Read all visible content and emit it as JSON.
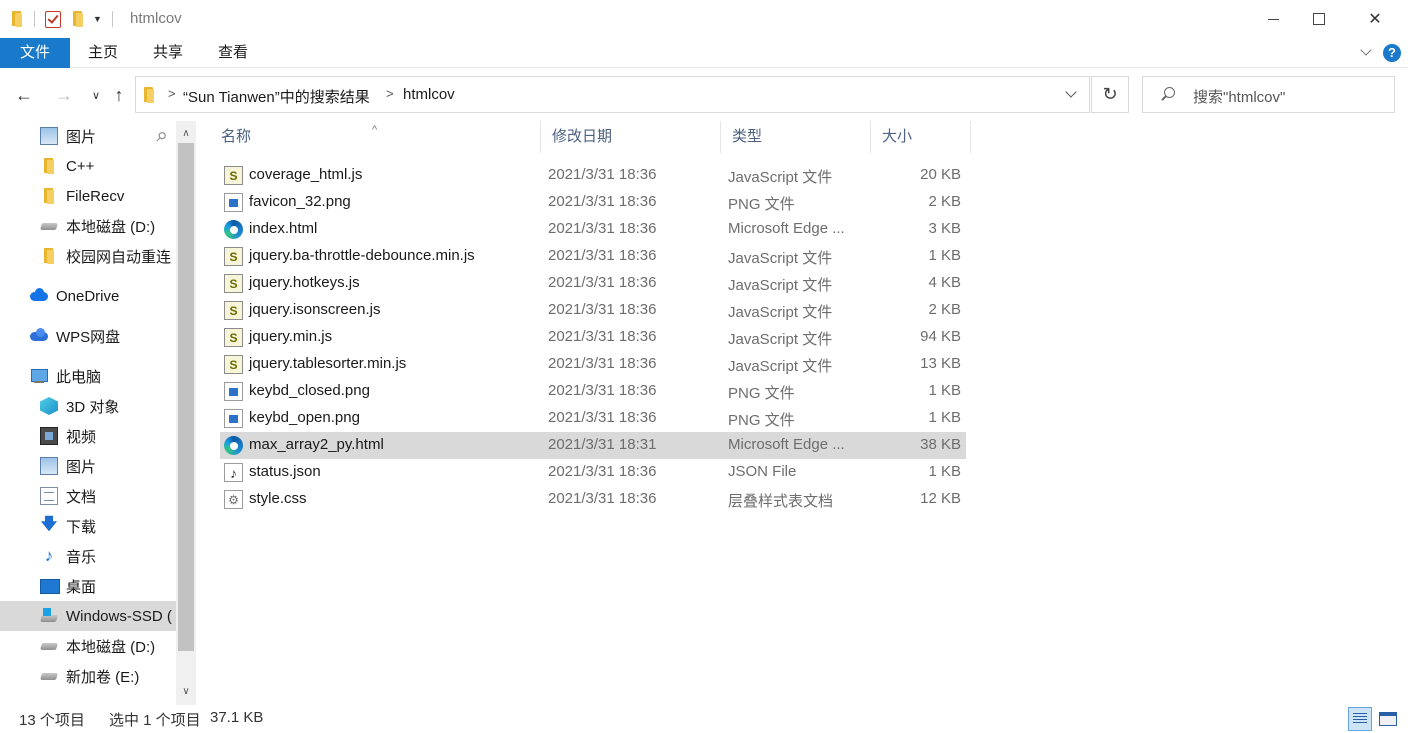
{
  "window": {
    "title": "htmlcov",
    "controls": {
      "minimize_icon": "minimize-icon",
      "maximize_icon": "maximize-icon",
      "close_icon": "close-icon",
      "close_glyph": "✕"
    }
  },
  "ribbon": {
    "tabs": [
      "文件",
      "主页",
      "共享",
      "查看"
    ],
    "help_glyph": "?"
  },
  "nav": {
    "back_glyph": "←",
    "forward_glyph": "→",
    "dropdown_glyph": "∨",
    "up_glyph": "↑",
    "breadcrumb": [
      "“Sun Tianwen”中的搜索结果",
      "htmlcov"
    ],
    "breadcrumb_sep": ">",
    "refresh_glyph": "↻",
    "search_placeholder": "搜索\"htmlcov\""
  },
  "sidebar": {
    "items": [
      {
        "label": "图片",
        "icon": "picture-icon",
        "pinned": true
      },
      {
        "label": "C++",
        "icon": "folder-icon"
      },
      {
        "label": "FileRecv",
        "icon": "folder-icon"
      },
      {
        "label": "本地磁盘 (D:)",
        "icon": "drive-icon"
      },
      {
        "label": "校园网自动重连",
        "icon": "folder-icon"
      },
      {
        "label": "OneDrive",
        "icon": "onedrive-icon"
      },
      {
        "label": "WPS网盘",
        "icon": "wps-cloud-icon"
      },
      {
        "label": "此电脑",
        "icon": "this-pc-icon"
      },
      {
        "label": "3D 对象",
        "icon": "3d-objects-icon"
      },
      {
        "label": "视频",
        "icon": "video-icon"
      },
      {
        "label": "图片",
        "icon": "picture-icon"
      },
      {
        "label": "文档",
        "icon": "document-icon"
      },
      {
        "label": "下载",
        "icon": "download-icon"
      },
      {
        "label": "音乐",
        "icon": "music-icon"
      },
      {
        "label": "桌面",
        "icon": "desktop-icon"
      },
      {
        "label": "Windows-SSD (",
        "icon": "windows-drive-icon",
        "selected": true
      },
      {
        "label": "本地磁盘 (D:)",
        "icon": "drive-icon"
      },
      {
        "label": "新加卷 (E:)",
        "icon": "drive-icon"
      }
    ],
    "pin_glyph": "📌",
    "scroll_up_glyph": "∧",
    "scroll_down_glyph": "∨"
  },
  "columns": {
    "name": "名称",
    "date": "修改日期",
    "type": "类型",
    "size": "大小",
    "sort_glyph": "^"
  },
  "files": [
    {
      "name": "coverage_html.js",
      "date": "2021/3/31 18:36",
      "type": "JavaScript 文件",
      "size": "20 KB",
      "icon": "js"
    },
    {
      "name": "favicon_32.png",
      "date": "2021/3/31 18:36",
      "type": "PNG 文件",
      "size": "2 KB",
      "icon": "png"
    },
    {
      "name": "index.html",
      "date": "2021/3/31 18:36",
      "type": "Microsoft Edge ...",
      "size": "3 KB",
      "icon": "edge"
    },
    {
      "name": "jquery.ba-throttle-debounce.min.js",
      "date": "2021/3/31 18:36",
      "type": "JavaScript 文件",
      "size": "1 KB",
      "icon": "js"
    },
    {
      "name": "jquery.hotkeys.js",
      "date": "2021/3/31 18:36",
      "type": "JavaScript 文件",
      "size": "4 KB",
      "icon": "js"
    },
    {
      "name": "jquery.isonscreen.js",
      "date": "2021/3/31 18:36",
      "type": "JavaScript 文件",
      "size": "2 KB",
      "icon": "js"
    },
    {
      "name": "jquery.min.js",
      "date": "2021/3/31 18:36",
      "type": "JavaScript 文件",
      "size": "94 KB",
      "icon": "js"
    },
    {
      "name": "jquery.tablesorter.min.js",
      "date": "2021/3/31 18:36",
      "type": "JavaScript 文件",
      "size": "13 KB",
      "icon": "js"
    },
    {
      "name": "keybd_closed.png",
      "date": "2021/3/31 18:36",
      "type": "PNG 文件",
      "size": "1 KB",
      "icon": "png"
    },
    {
      "name": "keybd_open.png",
      "date": "2021/3/31 18:36",
      "type": "PNG 文件",
      "size": "1 KB",
      "icon": "png"
    },
    {
      "name": "max_array2_py.html",
      "date": "2021/3/31 18:31",
      "type": "Microsoft Edge ...",
      "size": "38 KB",
      "icon": "edge",
      "selected": true
    },
    {
      "name": "status.json",
      "date": "2021/3/31 18:36",
      "type": "JSON File",
      "size": "1 KB",
      "icon": "json"
    },
    {
      "name": "style.css",
      "date": "2021/3/31 18:36",
      "type": "层叠样式表文档",
      "size": "12 KB",
      "icon": "css"
    }
  ],
  "status": {
    "item_count": "13 个项目",
    "selection": "选中 1 个项目",
    "selection_size": "37.1 KB"
  },
  "colors": {
    "accent": "#1979ca",
    "selection": "#d9d9d9",
    "header_text": "#4d6082"
  }
}
